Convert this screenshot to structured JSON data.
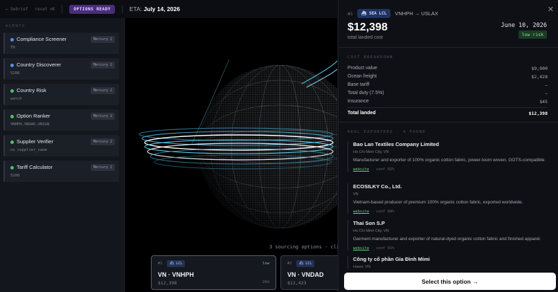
{
  "topbar": {
    "crumb1": "← Debrief",
    "crumb2": "reset ⌘K",
    "status_badge": "OPTIONS READY",
    "eta_label": "ETA:",
    "eta_value": "July 14, 2026"
  },
  "sidebar": {
    "heading": "AGENTS",
    "agents": [
      {
        "name": "Compliance Screener",
        "sub": "TH",
        "model": "Mercury 2",
        "dot_color": "#5b8def"
      },
      {
        "name": "Country Discoverer",
        "sub": "5208",
        "model": "Mercury 2",
        "dot_color": "#5b8def"
      },
      {
        "name": "Country Risk",
        "sub": "watch",
        "model": "Mercury 2",
        "dot_color": "#4cc36b"
      },
      {
        "name": "Option Ranker",
        "sub": "VNHPH,VNDAD,VNSGN",
        "model": "Mercury 2",
        "dot_color": "#4cc36b"
      },
      {
        "name": "Supplier Verifier",
        "sub": "no_supplier_name",
        "model": "Mercury 2",
        "dot_color": "#4cc36b"
      },
      {
        "name": "Tariff Calculator",
        "sub": "5208",
        "model": "Mercury 2",
        "dot_color": "#4cc36b"
      }
    ]
  },
  "stage": {
    "caption": "3 sourcing options · cli",
    "options": [
      {
        "rank": "#1",
        "mode": "LCL",
        "risk": "low",
        "route": "VN · VNHPH",
        "cost": "$12,398",
        "days": "26d"
      },
      {
        "rank": "#2",
        "mode": "LCL",
        "risk": "",
        "route": "VN · VNDAD",
        "cost": "$12,423",
        "days": ""
      }
    ]
  },
  "panel": {
    "rank": "#1",
    "mode": "SEA LCL",
    "lane": "VNHPH → USLAX",
    "total": "$12,398",
    "total_label": "total landed cost",
    "date": "June 10, 2026",
    "risk": "low risk",
    "breakdown_heading": "COST BREAKDOWN",
    "breakdown": [
      {
        "label": "Product value",
        "value": "$9,000"
      },
      {
        "label": "Ocean freight",
        "value": "$2,428"
      },
      {
        "label": "Base tariff",
        "value": "—"
      },
      {
        "label": "Total duty (7.5%)",
        "value": "—"
      },
      {
        "label": "Insurance",
        "value": "$45"
      }
    ],
    "total_row": {
      "label": "Total landed",
      "value": "$12,398"
    },
    "exporters_heading": "REAL EXPORTERS · 4 FOUND",
    "exporters": [
      {
        "name": "Bao Lan Textiles Company Limited",
        "location": "Ho Chi Minh City, VN",
        "desc": "Manufacturer and exporter of 100% organic cotton fabric, power-loom woven, GOTS-compatible.",
        "link": "website",
        "conf": "· conf 92%"
      },
      {
        "name": "ECOSILKY Co., Ltd.",
        "location": "VN",
        "desc": "Vietnam-based producer of premium 100% organic cotton fabric, exported worldwide.",
        "link": "website",
        "conf": "· conf 89%"
      },
      {
        "name": "Thai Son S.P",
        "location": "Ho Chi Minh City, VN",
        "desc": "Garment manufacturer and exporter of natural-dyed organic cotton fabric and finished apparel.",
        "link": "website",
        "conf": "· conf 91%"
      },
      {
        "name": "Công ty cổ phần Gia Đình Mimi",
        "location": "Hanoi, VN",
        "desc": "",
        "link": "",
        "conf": ""
      }
    ],
    "cta": "Select this option →"
  }
}
